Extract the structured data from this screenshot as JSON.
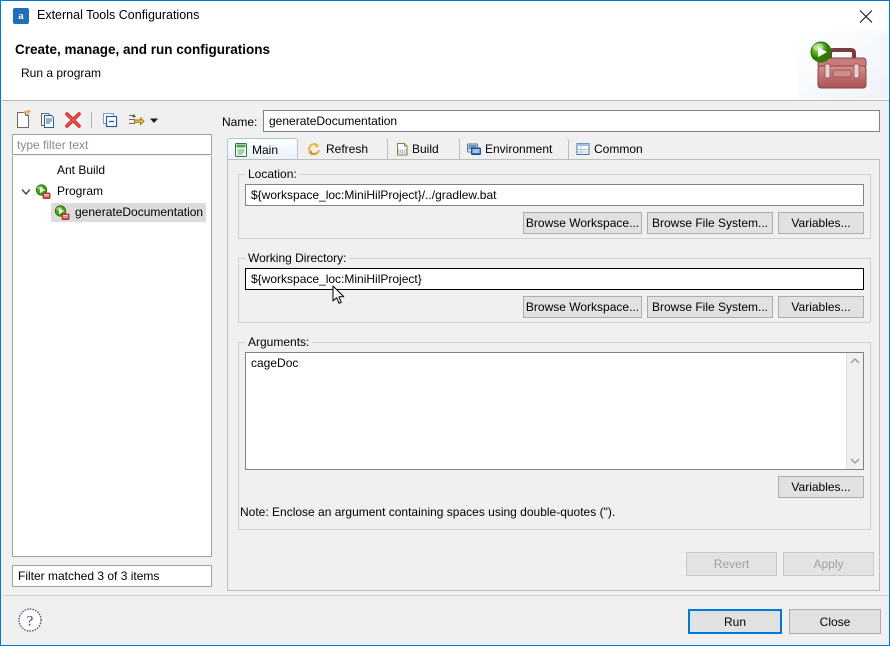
{
  "window": {
    "title": "External Tools Configurations",
    "icon": "ant-build-icon",
    "close_label": "Close window"
  },
  "header": {
    "title": "Create, manage, and run configurations",
    "subtitle": "Run a program",
    "graphic": "toolbox-with-run-badge-icon"
  },
  "left_panel": {
    "toolbar": [
      {
        "name": "new-configuration-icon",
        "tooltip": "New launch configuration"
      },
      {
        "name": "duplicate-configuration-icon",
        "tooltip": "Duplicate currently selected launch configuration"
      },
      {
        "name": "delete-configuration-icon",
        "tooltip": "Delete selected launch configuration(s)"
      },
      {
        "name": "collapse-all-icon",
        "tooltip": "Collapse All"
      },
      {
        "name": "filter-launch-configurations-icon",
        "tooltip": "Filter launch configurations"
      },
      {
        "name": "toolbar-dropdown-arrow-icon",
        "tooltip": "View Menu"
      }
    ],
    "filter": {
      "placeholder": "type filter text",
      "value": ""
    },
    "tree": [
      {
        "label": "Ant Build",
        "depth": 1,
        "expandable": false,
        "expanded": false,
        "selected": false,
        "icon": "none"
      },
      {
        "label": "Program",
        "depth": 0,
        "expandable": true,
        "expanded": true,
        "selected": false,
        "icon": "program-config-icon"
      },
      {
        "label": "generateDocumentation",
        "depth": 2,
        "expandable": false,
        "expanded": false,
        "selected": true,
        "icon": "program-config-icon"
      }
    ],
    "status": "Filter matched 3 of 3 items"
  },
  "right_panel": {
    "name_label": "Name:",
    "name_value": "generateDocumentation",
    "tabs": [
      {
        "label": "Main",
        "icon": "main-tab-icon",
        "selected": true
      },
      {
        "label": "Refresh",
        "icon": "refresh-tab-icon",
        "selected": false
      },
      {
        "label": "Build",
        "icon": "build-tab-icon",
        "selected": false
      },
      {
        "label": "Environment",
        "icon": "environment-tab-icon",
        "selected": false
      },
      {
        "label": "Common",
        "icon": "common-tab-icon",
        "selected": false
      }
    ],
    "location": {
      "label": "Location:",
      "value": "${workspace_loc:MiniHilProject}/../gradlew.bat",
      "focused": false,
      "buttons": [
        {
          "label": "Browse Workspace...",
          "name": "location-browse-workspace-button"
        },
        {
          "label": "Browse File System...",
          "name": "location-browse-file-system-button"
        },
        {
          "label": "Variables...",
          "name": "location-variables-button"
        }
      ]
    },
    "working_directory": {
      "label": "Working Directory:",
      "value": "${workspace_loc:MiniHilProject}",
      "focused": true,
      "buttons": [
        {
          "label": "Browse Workspace...",
          "name": "working-directory-browse-workspace-button"
        },
        {
          "label": "Browse File System...",
          "name": "working-directory-browse-file-system-button"
        },
        {
          "label": "Variables...",
          "name": "working-directory-variables-button"
        }
      ]
    },
    "arguments": {
      "label": "Arguments:",
      "value": "cageDoc",
      "variables_button": "Variables...",
      "note": "Note: Enclose an argument containing spaces using double-quotes (\")."
    },
    "revert_button": {
      "label": "Revert",
      "enabled": false
    },
    "apply_button": {
      "label": "Apply",
      "enabled": false
    }
  },
  "footer": {
    "help_icon": "help-question-icon",
    "run_button": {
      "label": "Run",
      "default": true
    },
    "close_button": {
      "label": "Close",
      "default": false
    }
  },
  "colors": {
    "window_border": "#0078d7",
    "default_button_border": "#0078d7",
    "selection": "#dcdcdc",
    "panel_bg": "#f0f0f0"
  }
}
